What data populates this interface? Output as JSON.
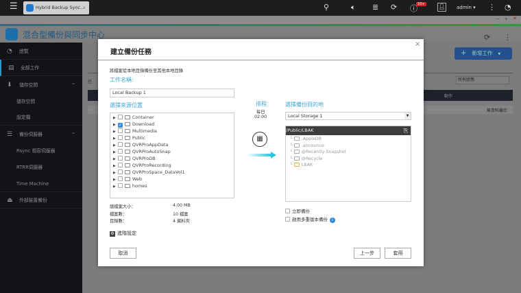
{
  "topbar": {
    "tab_title": "Hybrid Backup Sync...",
    "notification_badge": "10+",
    "user": "admin ▾"
  },
  "window_controls": {
    "minimize": "−",
    "maximize": "+",
    "close": "✕"
  },
  "app": {
    "title": "混合型備份與同步中心"
  },
  "sidebar": {
    "items": [
      {
        "label": "總覽",
        "icon": "gauge-icon"
      },
      {
        "label": "全部工作",
        "icon": "list-icon"
      },
      {
        "label": "儲存空間",
        "icon": "download-icon",
        "expanded": true
      },
      {
        "label": "儲存空間",
        "sub": true
      },
      {
        "label": "設定檔",
        "sub": true
      },
      {
        "label": "備份伺服器",
        "icon": "server-icon",
        "expanded": true
      },
      {
        "label": "Rsync 相容伺服器",
        "sub": true
      },
      {
        "label": "RTRR伺服器",
        "sub": true
      },
      {
        "label": "Time Machine",
        "sub": true
      },
      {
        "label": "外部裝置備份",
        "icon": "usb-backup-icon"
      }
    ]
  },
  "main": {
    "new_job": "新增工作",
    "status_filter": "所有狀態",
    "col_action": "動作",
    "empty": "無資料顯示",
    "partial_label": "已"
  },
  "modal": {
    "title": "建立備份任務",
    "description": "將檔案從本地目錄備份至其他本地目錄",
    "job_name_label": "工作名稱:",
    "job_name_value": "Local Backup 1",
    "source_label": "選擇來源位置",
    "source_folders": [
      {
        "name": "Container",
        "checked": false
      },
      {
        "name": "Download",
        "checked": true
      },
      {
        "name": "Multimedia",
        "checked": false
      },
      {
        "name": "Public",
        "checked": false
      },
      {
        "name": "QVRProAppData",
        "checked": false
      },
      {
        "name": "QVRProAutoSnap",
        "checked": false
      },
      {
        "name": "QVRProDB",
        "checked": false
      },
      {
        "name": "QVRProRecording",
        "checked": false
      },
      {
        "name": "QVRProSpace_DataVol1",
        "checked": false
      },
      {
        "name": "Web",
        "checked": false
      },
      {
        "name": "homes",
        "checked": false
      }
    ],
    "schedule_label": "排程",
    "schedule_freq": "每日",
    "schedule_time": "02:00",
    "dest_label": "選擇備份目的地",
    "dest_storage": "Local Storage 1",
    "dest_path": "/Public/LBAK",
    "dest_folders": [
      ".AppleDB",
      ".announce",
      "@Recently-Snapshot",
      "@Recycle",
      "LBAK"
    ],
    "stats": [
      {
        "label": "總檔案大小：",
        "value": "4.00 MB"
      },
      {
        "label": "檔案數：",
        "value": "10 檔案"
      },
      {
        "label": "目錄數：",
        "value": "4 資料夾"
      }
    ],
    "backup_now": "立即備份",
    "multi_version": "啟用多重版本備份",
    "advanced": "進階設定",
    "cancel": "取消",
    "back": "上一步",
    "apply": "套用",
    "close": "×"
  }
}
